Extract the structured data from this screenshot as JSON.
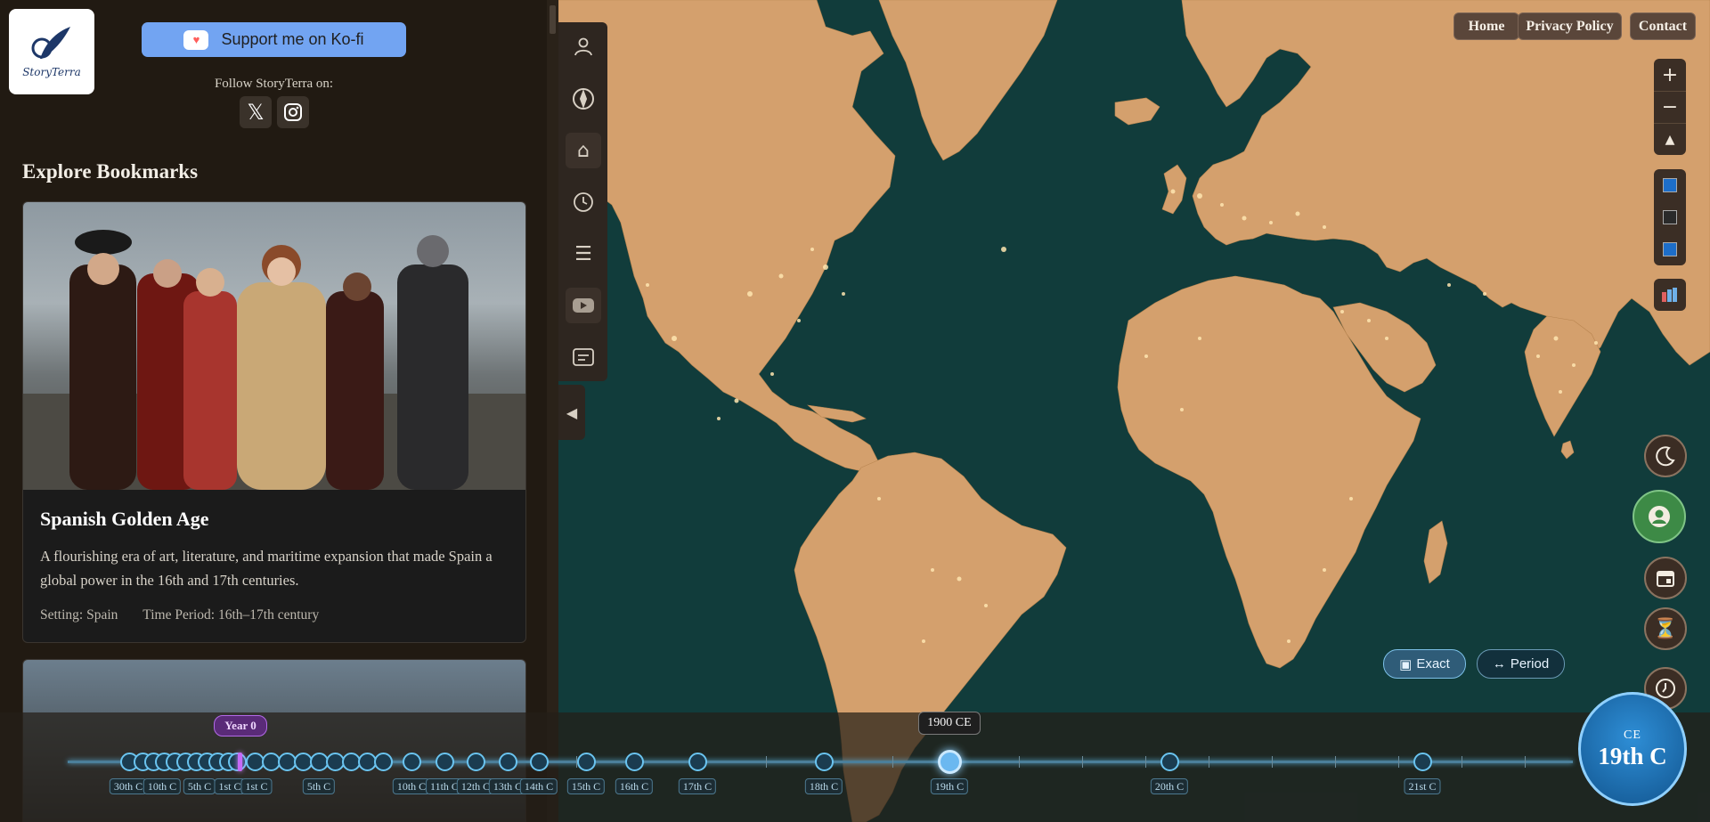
{
  "brand": {
    "logo_text": "StoryTerra",
    "logo_icon": "quill-logo-icon"
  },
  "support": {
    "label": "Support me on Ko-fi",
    "icon": "kofi-cup-icon"
  },
  "follow": {
    "text": "Follow StoryTerra on:",
    "links": [
      {
        "name": "x-icon"
      },
      {
        "name": "instagram-icon"
      }
    ]
  },
  "bookmarks": {
    "heading": "Explore Bookmarks",
    "cards": [
      {
        "title": "Spanish Golden Age",
        "description": "A flourishing era of art, literature, and maritime expansion that made Spain a global power in the 16th and 17th centuries.",
        "setting": "Setting: Spain",
        "time_period": "Time Period: 16th–17th century"
      }
    ]
  },
  "sidebar_icons": [
    "user-icon",
    "compass-icon",
    "home-icon",
    "clock-icon",
    "menu-icon",
    "youtube-icon",
    "subtitles-icon"
  ],
  "nav": {
    "home": "Home",
    "privacy": "Privacy Policy",
    "contact": "Contact"
  },
  "map_controls": {
    "zoom_in": "+",
    "zoom_out": "−",
    "north": "▲"
  },
  "mode_toggle": {
    "exact": "Exact",
    "period": "Period"
  },
  "timeline": {
    "year0_label": "Year 0",
    "current_date": "1900 CE",
    "era": "CE",
    "century": "19th C",
    "labels": [
      "30th C",
      "10th C",
      "5th C",
      "1st C",
      "1st C",
      "5th C",
      "10th C",
      "11th C",
      "12th C",
      "13th C",
      "14th C",
      "15th C",
      "16th C",
      "17th C",
      "18th C",
      "19th C",
      "20th C",
      "21st C"
    ]
  },
  "colors": {
    "land": "#d4a06d",
    "ocean": "#113c3b",
    "panel": "#211a12",
    "accent": "#6ac4f0"
  }
}
